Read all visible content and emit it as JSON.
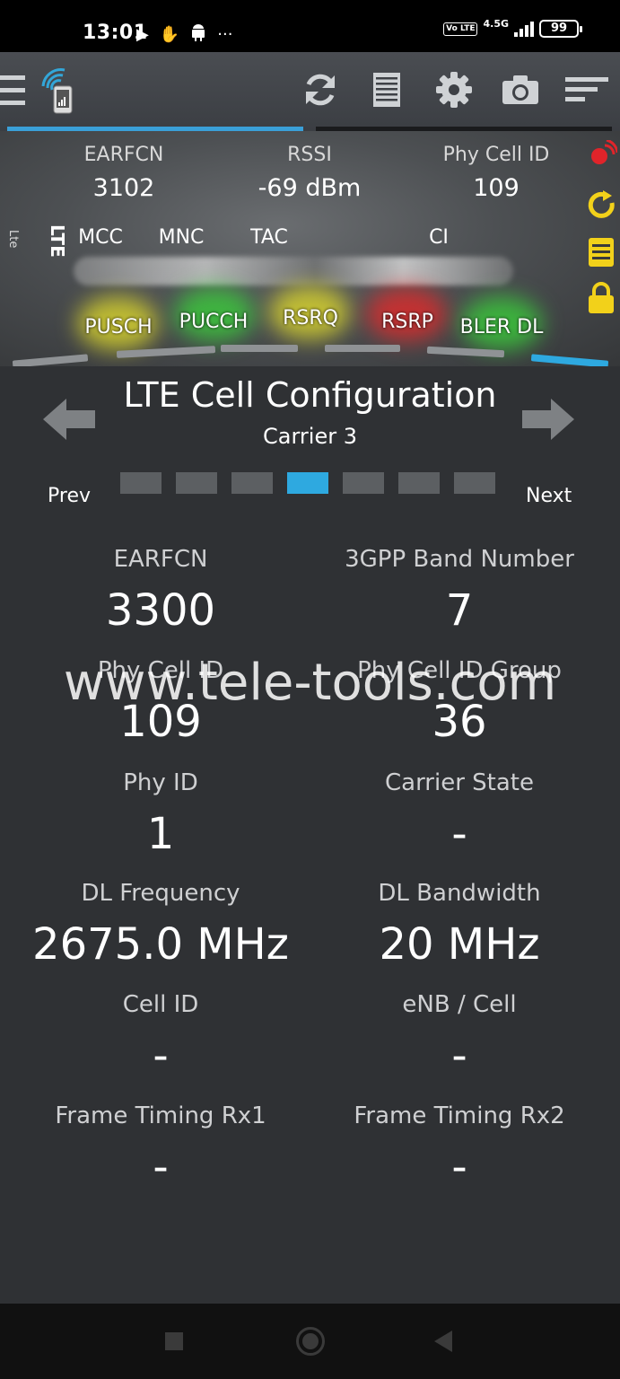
{
  "status_bar": {
    "time": "13:01",
    "volte": "Vo LTE",
    "network": "4.5G",
    "battery": "99",
    "more": "···"
  },
  "toolbar": {
    "icons": [
      "menu-icon",
      "app-signal-icon",
      "refresh-icon",
      "log-icon",
      "settings-icon",
      "camera-icon",
      "sort-icon"
    ]
  },
  "header": {
    "earfcn_label": "EARFCN",
    "earfcn_value": "3102",
    "rssi_label": "RSSI",
    "rssi_value": "-69 dBm",
    "pci_label": "Phy Cell ID",
    "pci_value": "109",
    "tech_small": "Lte",
    "tech_big": "LTE",
    "mcc_label": "MCC",
    "mnc_label": "MNC",
    "tac_label": "TAC",
    "ci_label": "CI",
    "meters": [
      {
        "label": "PUSCH",
        "color": "#e6e02a"
      },
      {
        "label": "PUCCH",
        "color": "#3ad43a"
      },
      {
        "label": "RSRQ",
        "color": "#e6e02a"
      },
      {
        "label": "RSRP",
        "color": "#e02a2a"
      },
      {
        "label": "BLER DL",
        "color": "#3ad43a"
      }
    ]
  },
  "page": {
    "title": "LTE Cell Configuration",
    "subtitle": "Carrier 3",
    "prev": "Prev",
    "next": "Next",
    "active_page": 4,
    "page_count": 7
  },
  "fields": [
    {
      "label": "EARFCN",
      "value": "3300"
    },
    {
      "label": "3GPP Band Number",
      "value": "7"
    },
    {
      "label": "Phy Cell ID",
      "value": "109"
    },
    {
      "label": "Phy Cell ID Group",
      "value": "36"
    },
    {
      "label": "Phy ID",
      "value": "1"
    },
    {
      "label": "Carrier State",
      "value": "-"
    },
    {
      "label": "DL Frequency",
      "value": "2675.0 MHz"
    },
    {
      "label": "DL Bandwidth",
      "value": "20 MHz"
    },
    {
      "label": "Cell ID",
      "value": "-"
    },
    {
      "label": "eNB / Cell",
      "value": "-"
    },
    {
      "label": "Frame Timing Rx1",
      "value": "-"
    },
    {
      "label": "Frame Timing Rx2",
      "value": "-"
    }
  ],
  "watermark": "www.tele-tools.com",
  "colors": {
    "accent": "#2ea9e0",
    "background": "#2f3134"
  }
}
